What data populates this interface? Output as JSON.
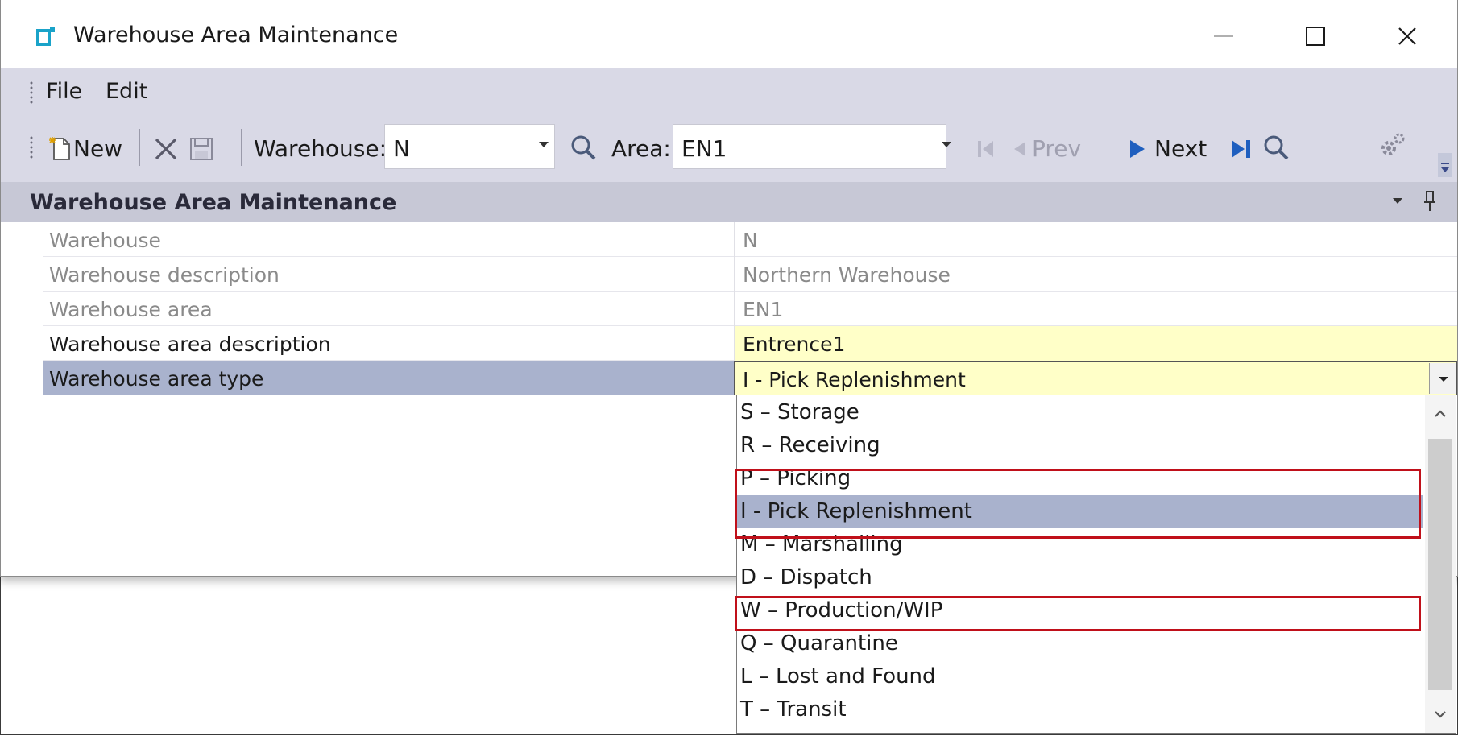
{
  "window": {
    "title": "Warehouse Area Maintenance"
  },
  "menu": {
    "items": [
      "File",
      "Edit"
    ]
  },
  "toolbar": {
    "new_label": "New",
    "warehouse_label": "Warehouse:",
    "warehouse_value": "N",
    "area_label": "Area:",
    "area_value": "EN1",
    "prev_label": "Prev",
    "next_label": "Next"
  },
  "panel": {
    "title": "Warehouse Area Maintenance"
  },
  "fields": [
    {
      "label": "Warehouse",
      "value": "N",
      "editable": false
    },
    {
      "label": "Warehouse description",
      "value": "Northern Warehouse",
      "editable": false
    },
    {
      "label": "Warehouse area",
      "value": "EN1",
      "editable": false
    },
    {
      "label": "Warehouse area description",
      "value": "Entrence1",
      "editable": true
    },
    {
      "label": "Warehouse area type",
      "value": "I - Pick Replenishment",
      "editable": true,
      "selected": true
    }
  ],
  "area_type_options": [
    "S – Storage",
    "R – Receiving",
    "P – Picking",
    "I - Pick Replenishment",
    "M – Marshalling",
    "D – Dispatch",
    "W – Production/WIP",
    "Q – Quarantine",
    "L – Lost and Found",
    "T – Transit"
  ],
  "selected_option": "I - Pick Replenishment",
  "colors": {
    "toolbar_bg": "#d9d9e6",
    "selection": "#a9b2cd",
    "editable_cell": "#ffffc8",
    "highlight_box": "#c0101a",
    "nav_blue": "#1f5fbf",
    "app_icon": "#1aa3c9"
  }
}
